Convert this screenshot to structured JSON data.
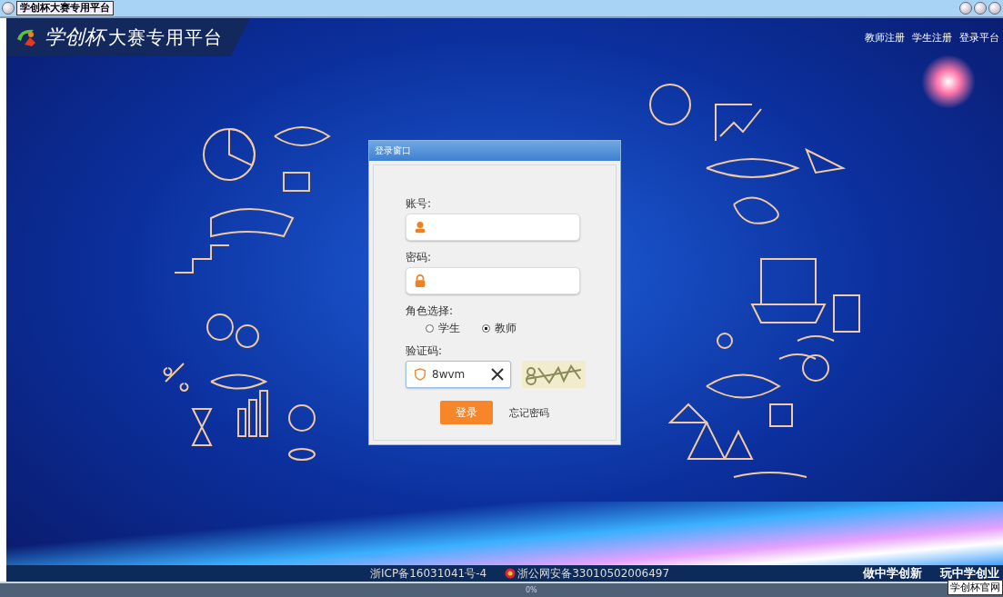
{
  "window": {
    "tab_title": "学创杯大赛专用平台"
  },
  "header": {
    "logo_mark": "学创杯",
    "logo_text": "大赛专用平台",
    "nav": [
      "教师注册",
      "学生注册",
      "登录平台"
    ]
  },
  "login": {
    "title": "登录窗口",
    "account": {
      "label": "账号:"
    },
    "password": {
      "label": "密码:"
    },
    "role": {
      "label": "角色选择:",
      "options": [
        {
          "label": "学生",
          "selected": false
        },
        {
          "label": "教师",
          "selected": true
        }
      ]
    },
    "captcha": {
      "label": "验证码:",
      "value": "8wvm"
    },
    "submit": "登录",
    "forgot": "忘记密码"
  },
  "footer": {
    "icp": "浙ICP备16031041号-4",
    "police": "浙公网安备33010502006497",
    "slogans": [
      "做中学创新",
      "玩中学创业"
    ]
  },
  "status_bar": {
    "progress": "0%"
  },
  "tooltip": "学创杯官网"
}
